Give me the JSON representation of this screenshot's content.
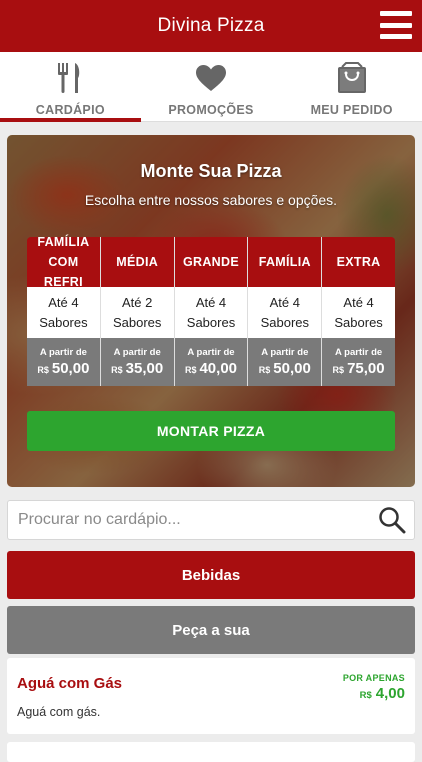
{
  "header": {
    "title": "Divina Pizza",
    "menu_icon": "hamburger-menu-icon"
  },
  "tabs": [
    {
      "label": "CARDÁPIO",
      "icon": "fork-knife-icon",
      "active": true
    },
    {
      "label": "PROMOÇÕES",
      "icon": "heart-icon",
      "active": false
    },
    {
      "label": "MEU PEDIDO",
      "icon": "shopping-bag-icon",
      "active": false
    }
  ],
  "hero": {
    "title": "Monte Sua Pizza",
    "subtitle": "Escolha entre nossos sabores e opções.",
    "sizes": [
      {
        "name_line1": "FAMÍLIA",
        "name_line2": "COM REFRI",
        "flavors_line1": "Até 4",
        "flavors_line2": "Sabores",
        "from": "A partir de",
        "currency": "R$",
        "price": "50,00"
      },
      {
        "name_line1": "MÉDIA",
        "name_line2": "",
        "flavors_line1": "Até 2",
        "flavors_line2": "Sabores",
        "from": "A partir de",
        "currency": "R$",
        "price": "35,00"
      },
      {
        "name_line1": "GRANDE",
        "name_line2": "",
        "flavors_line1": "Até 4",
        "flavors_line2": "Sabores",
        "from": "A partir de",
        "currency": "R$",
        "price": "40,00"
      },
      {
        "name_line1": "FAMÍLIA",
        "name_line2": "",
        "flavors_line1": "Até 4",
        "flavors_line2": "Sabores",
        "from": "A partir de",
        "currency": "R$",
        "price": "50,00"
      },
      {
        "name_line1": "EXTRA",
        "name_line2": "",
        "flavors_line1": "Até 4",
        "flavors_line2": "Sabores",
        "from": "A partir de",
        "currency": "R$",
        "price": "75,00"
      }
    ],
    "build_button": "MONTAR PIZZA"
  },
  "search": {
    "placeholder": "Procurar no cardápio...",
    "value": "",
    "icon": "search-icon"
  },
  "categories": {
    "drinks": "Bebidas",
    "custom": "Peça a sua"
  },
  "item": {
    "name": "Aguá com Gás",
    "description": "Aguá com gás.",
    "price_label": "POR APENAS",
    "currency": "R$",
    "price": "4,00"
  },
  "colors": {
    "brand_red": "#a80e10",
    "green": "#2da52f",
    "gray": "#7a7a7a"
  }
}
